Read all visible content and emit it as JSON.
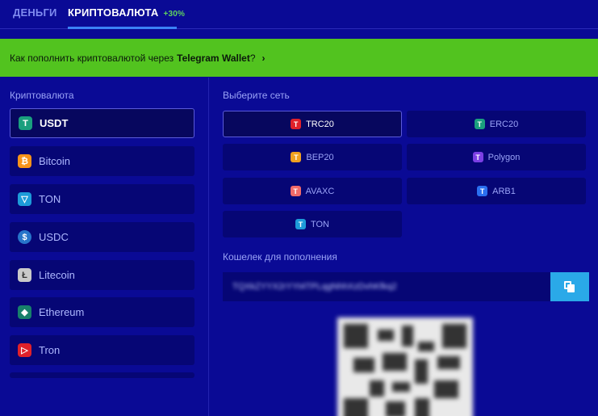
{
  "tabs": {
    "money": "ДЕНЬГИ",
    "crypto": "КРИПТОВАЛЮТА",
    "crypto_bonus": "+30%"
  },
  "banner": {
    "text": "Как пополнить криптовалютой через",
    "bold": "Telegram Wallet",
    "suffix": "?",
    "chevron": "›"
  },
  "crypto_section": {
    "label": "Криптовалюта",
    "items": [
      {
        "label": "USDT",
        "icon": "tether-icon",
        "glyph": "T",
        "color": "#1a9f7e",
        "selected": true
      },
      {
        "label": "Bitcoin",
        "icon": "bitcoin-icon",
        "glyph": "₿",
        "color": "#f7931a",
        "selected": false
      },
      {
        "label": "TON",
        "icon": "ton-icon",
        "glyph": "▽",
        "color": "#1d9bd9",
        "selected": false
      },
      {
        "label": "USDC",
        "icon": "usdc-icon",
        "glyph": "$",
        "color": "#2775ca",
        "selected": false
      },
      {
        "label": "Litecoin",
        "icon": "litecoin-icon",
        "glyph": "Ł",
        "color": "#c9c9c9",
        "selected": false
      },
      {
        "label": "Ethereum",
        "icon": "ethereum-icon",
        "glyph": "◆",
        "color": "#17806a",
        "selected": false
      },
      {
        "label": "Tron",
        "icon": "tron-icon",
        "glyph": "▷",
        "color": "#e0212a",
        "selected": false
      }
    ]
  },
  "network_section": {
    "label": "Выберите сеть",
    "networks": [
      {
        "label": "TRC20",
        "color": "#e0212a",
        "selected": true
      },
      {
        "label": "ERC20",
        "color": "#1a9f7e",
        "selected": false
      },
      {
        "label": "BEP20",
        "color": "#f0a020",
        "selected": false
      },
      {
        "label": "Polygon",
        "color": "#7b3fe4",
        "selected": false
      },
      {
        "label": "AVAXC",
        "color": "#f06a6a",
        "selected": false
      },
      {
        "label": "ARB1",
        "color": "#2a6ff0",
        "selected": false
      },
      {
        "label": "TON",
        "color": "#1d9bd9",
        "selected": false
      }
    ]
  },
  "wallet": {
    "label": "Кошелек для пополнения",
    "address": "TQXkZYYX2rYYt4TPLqgNhhXzDvhKfkq2"
  },
  "colors": {
    "background": "#0a0a95",
    "banner": "#52c31f",
    "copy_button": "#2aa9e8"
  }
}
